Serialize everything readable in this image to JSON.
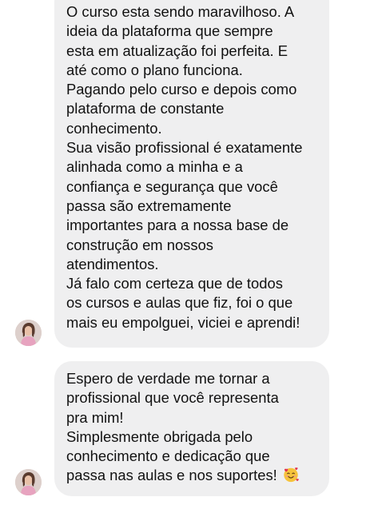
{
  "messages": [
    {
      "paragraphs": [
        {
          "lines": [
            "O curso esta sendo maravilhoso. A",
            "ideia da plataforma que sempre",
            "esta em atualização foi perfeita. E",
            "até como o plano funciona.",
            "Pagando pelo curso e depois como",
            "plataforma de constante",
            "conhecimento."
          ]
        },
        {
          "lines": [
            "Sua visão profissional é exatamente",
            "alinhada como a minha e a",
            "confiança e segurança que você",
            "passa são extremamente",
            "importantes para a nossa base de",
            "construção em nossos",
            "atendimentos."
          ]
        },
        {
          "lines": [
            "Já falo com certeza que de todos",
            "os cursos e aulas que fiz, foi o que",
            "mais eu empolguei, viciei e aprendi!"
          ]
        }
      ]
    },
    {
      "paragraphs": [
        {
          "lines": [
            "Espero de verdade me tornar a",
            "profissional que você representa",
            "pra mim!"
          ]
        },
        {
          "lines": [
            "Simplesmente obrigada pelo",
            "conhecimento e dedicação que",
            "passa nas aulas e nos suportes!"
          ],
          "trailing_icon": "smiling-face-with-hearts-icon"
        }
      ]
    }
  ],
  "avatar_icon": "sender-avatar-icon",
  "colors": {
    "bubble_background": "#efeff0",
    "text": "#111111",
    "page_background": "#ffffff",
    "emoji_face": "#f6c33b",
    "emoji_hearts": "#e2334b"
  }
}
